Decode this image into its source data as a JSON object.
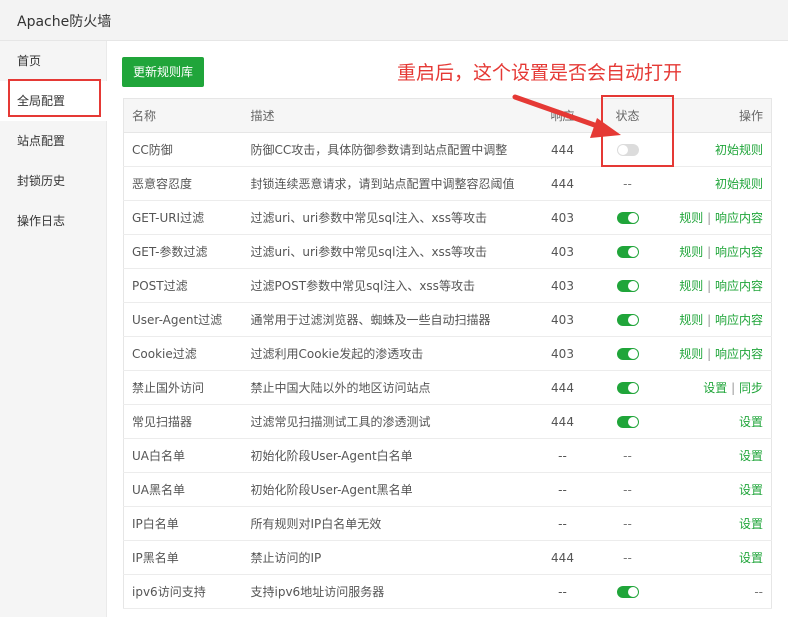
{
  "window": {
    "title": "Apache防火墙"
  },
  "sidebar": {
    "items": [
      {
        "label": "首页",
        "active": false
      },
      {
        "label": "全局配置",
        "active": true
      },
      {
        "label": "站点配置",
        "active": false
      },
      {
        "label": "封锁历史",
        "active": false
      },
      {
        "label": "操作日志",
        "active": false
      }
    ]
  },
  "toolbar": {
    "update_label": "更新规则库"
  },
  "annotation": {
    "text": "重启后，这个设置是否会自动打开"
  },
  "table": {
    "headers": {
      "name": "名称",
      "desc": "描述",
      "code": "响应",
      "status": "状态",
      "ops": "操作"
    },
    "rows": [
      {
        "name": "CC防御",
        "desc": "防御CC攻击，具体防御参数请到站点配置中调整",
        "code": "444",
        "status": "off",
        "ops": [
          "初始规则"
        ]
      },
      {
        "name": "恶意容忍度",
        "desc": "封锁连续恶意请求，请到站点配置中调整容忍阈值",
        "code": "444",
        "status": "--",
        "ops": [
          "初始规则"
        ]
      },
      {
        "name": "GET-URI过滤",
        "desc": "过滤uri、uri参数中常见sql注入、xss等攻击",
        "code": "403",
        "status": "on",
        "ops": [
          "规则",
          "响应内容"
        ]
      },
      {
        "name": "GET-参数过滤",
        "desc": "过滤uri、uri参数中常见sql注入、xss等攻击",
        "code": "403",
        "status": "on",
        "ops": [
          "规则",
          "响应内容"
        ]
      },
      {
        "name": "POST过滤",
        "desc": "过滤POST参数中常见sql注入、xss等攻击",
        "code": "403",
        "status": "on",
        "ops": [
          "规则",
          "响应内容"
        ]
      },
      {
        "name": "User-Agent过滤",
        "desc": "通常用于过滤浏览器、蜘蛛及一些自动扫描器",
        "code": "403",
        "status": "on",
        "ops": [
          "规则",
          "响应内容"
        ]
      },
      {
        "name": "Cookie过滤",
        "desc": "过滤利用Cookie发起的渗透攻击",
        "code": "403",
        "status": "on",
        "ops": [
          "规则",
          "响应内容"
        ]
      },
      {
        "name": "禁止国外访问",
        "desc": "禁止中国大陆以外的地区访问站点",
        "code": "444",
        "status": "on",
        "ops": [
          "设置",
          "同步"
        ]
      },
      {
        "name": "常见扫描器",
        "desc": "过滤常见扫描测试工具的渗透测试",
        "code": "444",
        "status": "on",
        "ops": [
          "设置"
        ]
      },
      {
        "name": "UA白名单",
        "desc": "初始化阶段User-Agent白名单",
        "code": "--",
        "status": "--",
        "ops": [
          "设置"
        ]
      },
      {
        "name": "UA黑名单",
        "desc": "初始化阶段User-Agent黑名单",
        "code": "--",
        "status": "--",
        "ops": [
          "设置"
        ]
      },
      {
        "name": "IP白名单",
        "desc": "所有规则对IP白名单无效",
        "code": "--",
        "status": "--",
        "ops": [
          "设置"
        ]
      },
      {
        "name": "IP黑名单",
        "desc": "禁止访问的IP",
        "code": "444",
        "status": "--",
        "ops": [
          "设置"
        ]
      },
      {
        "name": "ipv6访问支持",
        "desc": "支持ipv6地址访问服务器",
        "code": "--",
        "status": "on",
        "ops": [
          "--"
        ]
      }
    ]
  },
  "colors": {
    "accent": "#20a53a",
    "annotation": "#e53935"
  }
}
